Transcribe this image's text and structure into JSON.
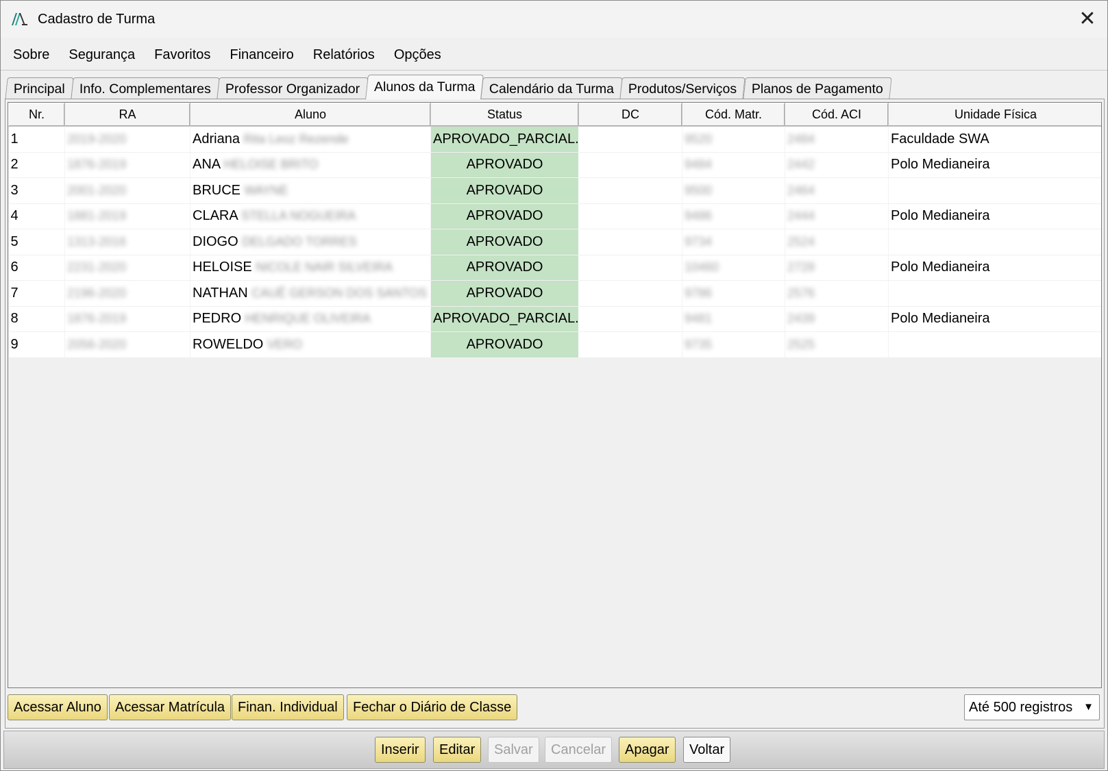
{
  "window": {
    "title": "Cadastro de Turma"
  },
  "menu": [
    "Sobre",
    "Segurança",
    "Favoritos",
    "Financeiro",
    "Relatórios",
    "Opções"
  ],
  "tabs": [
    "Principal",
    "Info. Complementares",
    "Professor Organizador",
    "Alunos da Turma",
    "Calendário da Turma",
    "Produtos/Serviços",
    "Planos de Pagamento"
  ],
  "active_tab": "Alunos da Turma",
  "grid": {
    "columns": [
      "Nr.",
      "RA",
      "Aluno",
      "Status",
      "DC",
      "Cód. Matr.",
      "Cód. ACI",
      "Unidade Física"
    ],
    "rows": [
      {
        "nr": "1",
        "ra": "2019-2020",
        "first": "Adriana",
        "rest": "Rita Leoz Rezende",
        "status": "APROVADO_PARCIAL...",
        "dc": "",
        "matr": "9520",
        "aci": "2484",
        "unidade": "Faculdade SWA"
      },
      {
        "nr": "2",
        "ra": "1876-2019",
        "first": "ANA",
        "rest": "HELOISE BRITO",
        "status": "APROVADO",
        "dc": "",
        "matr": "9484",
        "aci": "2442",
        "unidade": "Polo Medianeira"
      },
      {
        "nr": "3",
        "ra": "2001-2020",
        "first": "BRUCE",
        "rest": "WAYNE",
        "status": "APROVADO",
        "dc": "",
        "matr": "9500",
        "aci": "2464",
        "unidade": ""
      },
      {
        "nr": "4",
        "ra": "1881-2019",
        "first": "CLARA",
        "rest": "STELLA NOGUEIRA",
        "status": "APROVADO",
        "dc": "",
        "matr": "9486",
        "aci": "2444",
        "unidade": "Polo Medianeira"
      },
      {
        "nr": "5",
        "ra": "1313-2016",
        "first": "DIOGO",
        "rest": "DELGADO TORRES",
        "status": "APROVADO",
        "dc": "",
        "matr": "9734",
        "aci": "2524",
        "unidade": ""
      },
      {
        "nr": "6",
        "ra": "2231-2020",
        "first": "HELOISE",
        "rest": "NICOLE NAIR SILVEIRA",
        "status": "APROVADO",
        "dc": "",
        "matr": "10460",
        "aci": "2728",
        "unidade": "Polo Medianeira"
      },
      {
        "nr": "7",
        "ra": "2196-2020",
        "first": "NATHAN",
        "rest": "CAUÊ GERSON DOS SANTOS",
        "status": "APROVADO",
        "dc": "",
        "matr": "9786",
        "aci": "2576",
        "unidade": ""
      },
      {
        "nr": "8",
        "ra": "1876-2019",
        "first": "PEDRO",
        "rest": "HENRIQUE OLIVEIRA",
        "status": "APROVADO_PARCIAL...",
        "dc": "",
        "matr": "9481",
        "aci": "2439",
        "unidade": "Polo Medianeira"
      },
      {
        "nr": "9",
        "ra": "2056-2020",
        "first": "ROWELDO",
        "rest": "VERO",
        "status": "APROVADO",
        "dc": "",
        "matr": "9735",
        "aci": "2525",
        "unidade": ""
      }
    ]
  },
  "panel_buttons": [
    "Acessar Aluno",
    "Acessar Matrícula",
    "Finan. Individual",
    "Fechar o Diário de Classe"
  ],
  "records_select": {
    "value": "Até 500 registros"
  },
  "toolbar": {
    "inserir": "Inserir",
    "editar": "Editar",
    "salvar": "Salvar",
    "cancelar": "Cancelar",
    "apagar": "Apagar",
    "voltar": "Voltar"
  },
  "colors": {
    "status_bg": "#c4e2c4",
    "button_yellow": "#f3e59b",
    "logo": "#1aa59a"
  }
}
